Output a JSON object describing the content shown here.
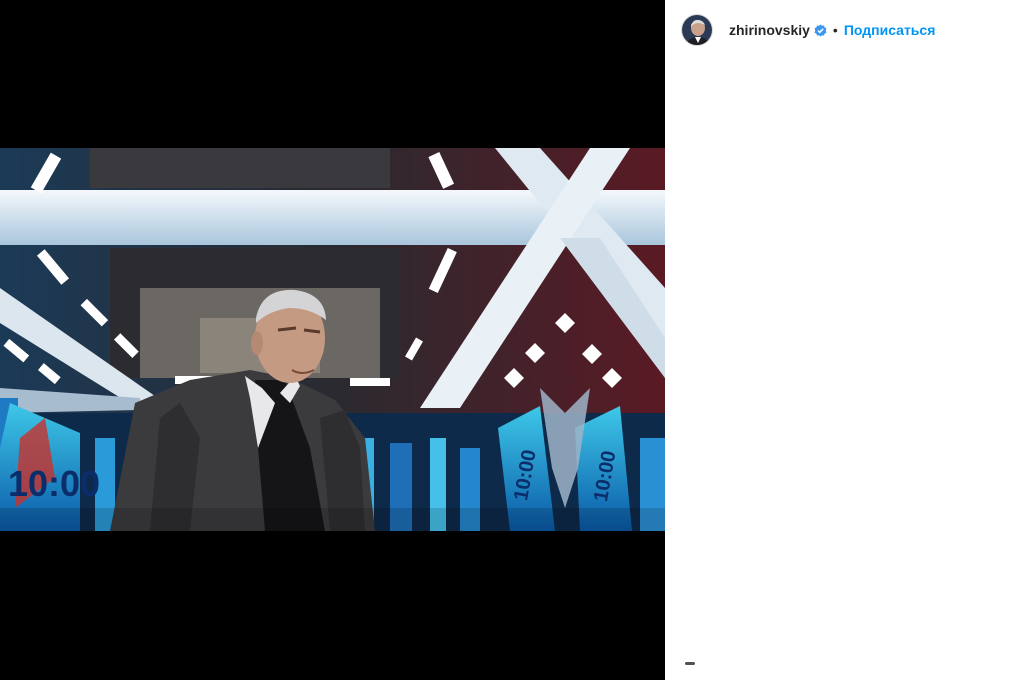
{
  "header": {
    "username": "zhirinovskiy",
    "separator": "•",
    "follow_label": "Подписаться"
  },
  "media": {
    "screen_text_left": "10:00",
    "screen_text_mid": "10:00",
    "screen_text_right": "10:00"
  },
  "colors": {
    "follow": "#0095f6",
    "verified": "#3897f0",
    "text": "#262626"
  },
  "icons": {
    "verified": "verified-badge-icon",
    "avatar": "profile-avatar"
  }
}
